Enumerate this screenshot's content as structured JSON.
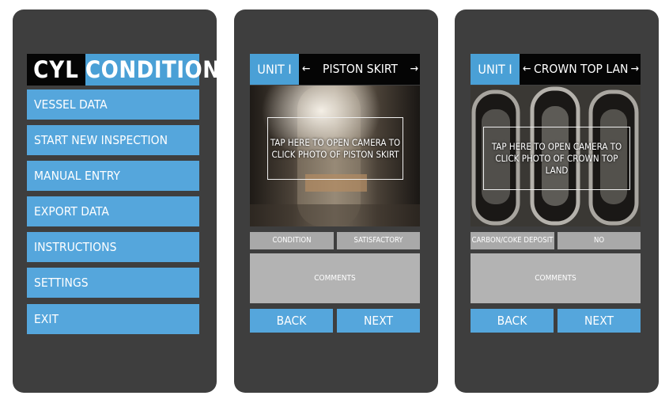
{
  "main_menu": {
    "logo": {
      "part1": "CYL",
      "part2": "CONDITION"
    },
    "items": [
      {
        "label": "VESSEL DATA"
      },
      {
        "label": "START NEW INSPECTION"
      },
      {
        "label": "MANUAL ENTRY"
      },
      {
        "label": "EXPORT DATA"
      },
      {
        "label": "INSTRUCTIONS"
      },
      {
        "label": "SETTINGS"
      },
      {
        "label": "EXIT"
      }
    ]
  },
  "piston_skirt_screen": {
    "unit": "UNIT I",
    "arrow_left": "←",
    "title": "PISTON SKIRT",
    "arrow_right": "→",
    "photo_prompt": "TAP HERE TO OPEN CAMERA TO CLICK PHOTO OF PISTON SKIRT",
    "field_label": "CONDITION",
    "field_value": "SATISFACTORY",
    "comments_placeholder": "COMMENTS",
    "back_label": "BACK",
    "next_label": "NEXT"
  },
  "crown_top_land_screen": {
    "unit": "UNIT I",
    "arrow_left": "←",
    "title": "CROWN TOP LAND",
    "arrow_right": "→",
    "photo_prompt": "TAP HERE TO OPEN CAMERA TO CLICK PHOTO OF CROWN TOP LAND",
    "field_label": "CARBON/COKE DEPOSIT",
    "field_value": "NO",
    "comments_placeholder": "COMMENTS",
    "back_label": "BACK",
    "next_label": "NEXT"
  },
  "colors": {
    "phone_body": "#3e3e3e",
    "accent_blue": "#55a6dc",
    "header_black": "#050505",
    "field_gray": "#a9a9a9",
    "comments_gray": "#b3b3b3"
  }
}
